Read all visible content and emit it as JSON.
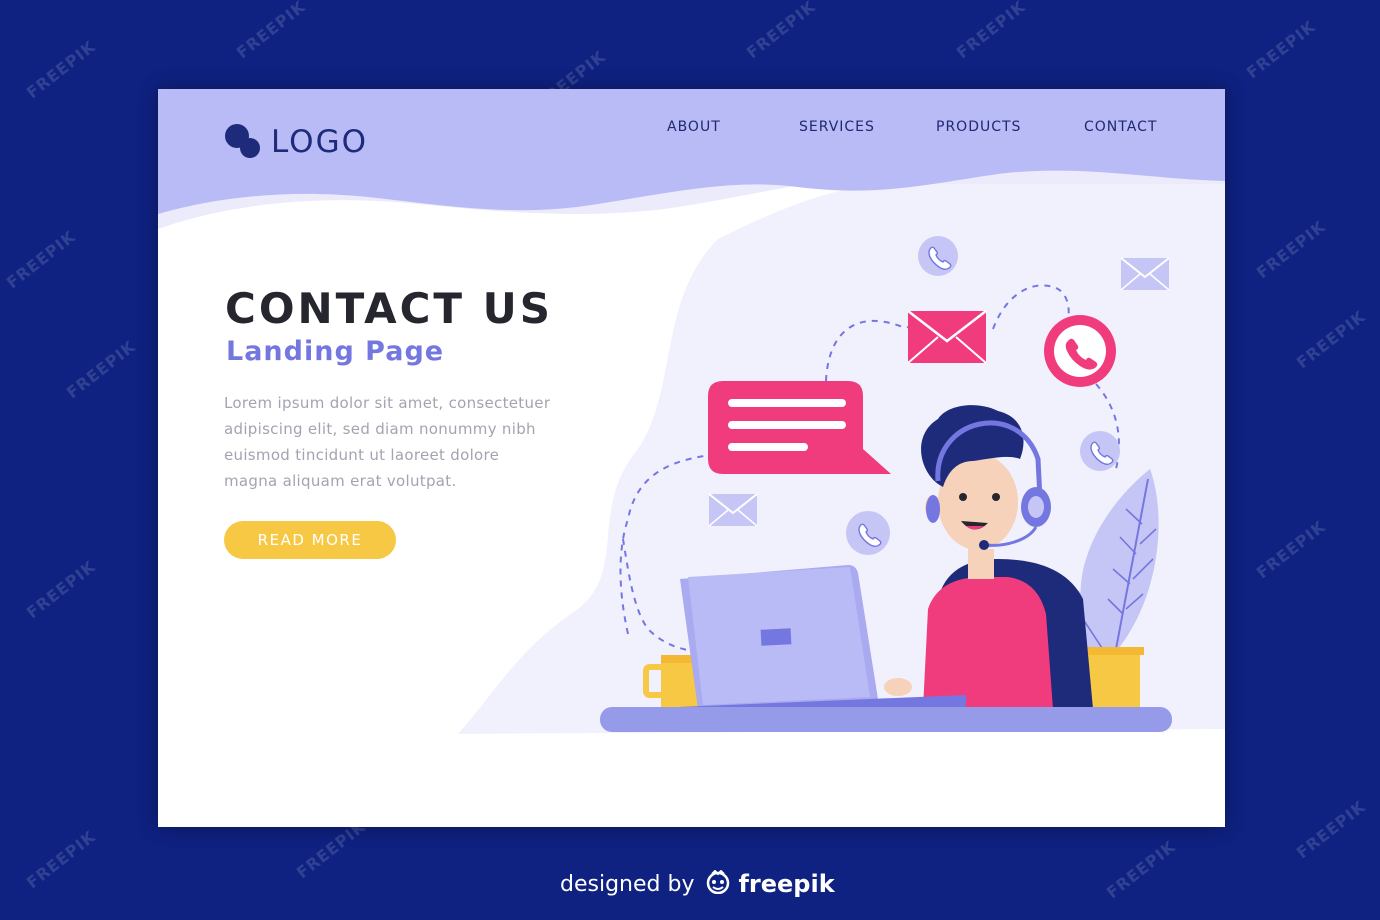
{
  "brand": {
    "logo_text": "LOGO",
    "logo_icon": "bubbles-icon"
  },
  "nav": {
    "items": [
      {
        "label": "ABOUT"
      },
      {
        "label": "SERVICES"
      },
      {
        "label": "PRODUCTS"
      },
      {
        "label": "CONTACT"
      }
    ]
  },
  "hero": {
    "title": "CONTACT US",
    "subtitle": "Landing Page",
    "body_lines": [
      "Lorem ipsum dolor sit amet, consectetuer",
      "adipiscing elit, sed diam nonummy nibh",
      "euismod tincidunt ut laoreet dolore",
      "magna aliquam erat volutpat."
    ],
    "cta_label": "READ MORE"
  },
  "footer": {
    "designed_by": "designed by",
    "brand": "freepik",
    "brand_icon": "freepik-face-icon"
  },
  "watermark": {
    "text": "FREEPIK"
  },
  "colors": {
    "page_bg": "#0f2181",
    "header_wave": "#b9bbf6",
    "hero_bg": "#f1f1fd",
    "accent_pink": "#f03c7c",
    "accent_purple": "#7577e0",
    "button_yellow": "#f7c844",
    "title_text": "#26262e",
    "nav_text": "#1f2870"
  }
}
